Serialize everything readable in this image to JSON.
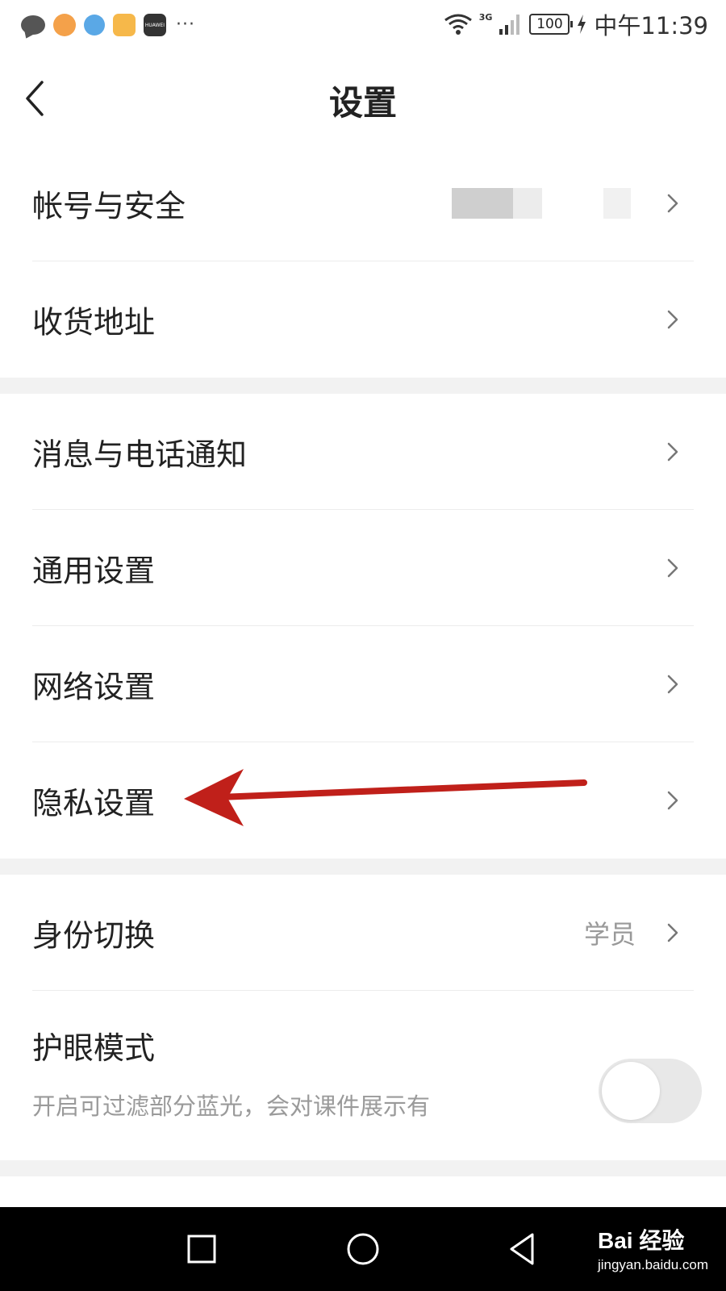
{
  "status_bar": {
    "network": "3G",
    "battery": "100",
    "time": "中午11:39",
    "more": "···",
    "huawei": "HUAWEI"
  },
  "header": {
    "title": "设置"
  },
  "groups": {
    "account": [
      {
        "label": "帐号与安全"
      },
      {
        "label": "收货地址"
      }
    ],
    "settings": [
      {
        "label": "消息与电话通知"
      },
      {
        "label": "通用设置"
      },
      {
        "label": "网络设置"
      },
      {
        "label": "隐私设置"
      }
    ],
    "identity": {
      "label": "身份切换",
      "value": "学员"
    },
    "eye_mode": {
      "label": "护眼模式",
      "description": "开启可过滤部分蓝光，会对课件展示有",
      "enabled": false
    }
  },
  "annotation": {
    "arrow_color": "#c0201a"
  },
  "watermark": {
    "brand": "Bai 经验",
    "url": "jingyan.baidu.com"
  }
}
